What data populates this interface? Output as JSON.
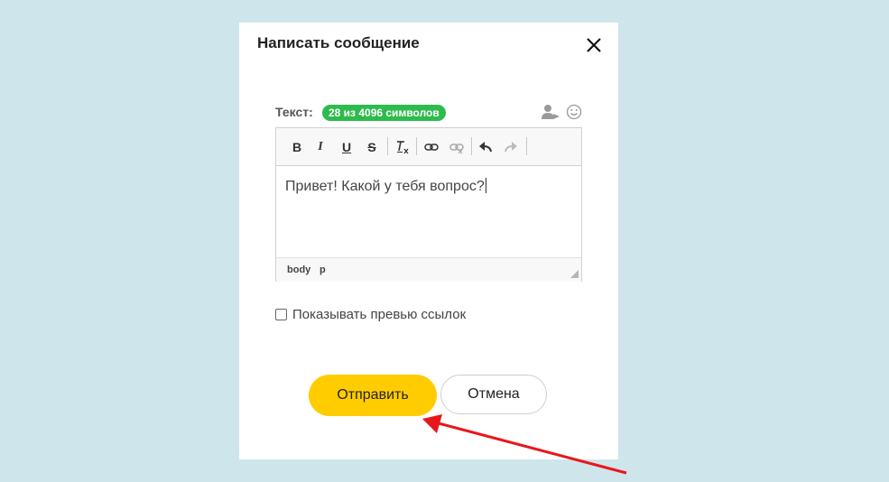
{
  "dialog": {
    "title": "Написать сообщение"
  },
  "composer": {
    "text_label": "Текст:",
    "char_counter": "28 из 4096 символов",
    "content": "Привет! Какой у тебя вопрос?",
    "toolbar": {
      "bold": "B",
      "italic": "I",
      "underline": "U",
      "strike": "S"
    },
    "statusbar": {
      "path": [
        "body",
        "p"
      ]
    }
  },
  "options": {
    "link_preview_label": "Показывать превью ссылок",
    "link_preview_checked": false
  },
  "actions": {
    "send_label": "Отправить",
    "cancel_label": "Отмена"
  },
  "colors": {
    "background": "#cfe5ec",
    "badge": "#2ebb4e",
    "primary_button": "#ffcc00",
    "annotation_arrow": "#e8171b"
  },
  "icons": [
    "close-icon",
    "mention-user-icon",
    "emoji-icon",
    "remove-format-icon",
    "link-icon",
    "unlink-icon",
    "undo-icon",
    "redo-icon",
    "resize-grip-icon"
  ]
}
